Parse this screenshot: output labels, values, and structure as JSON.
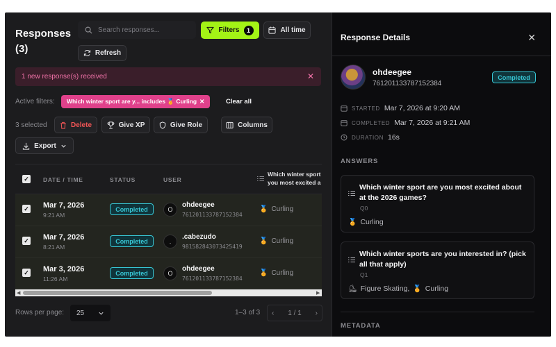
{
  "title": {
    "line1": "Responses",
    "line2": "(3)"
  },
  "search": {
    "placeholder": "Search responses..."
  },
  "toolbar": {
    "filters_label": "Filters",
    "filters_count": "1",
    "alltime_label": "All time",
    "refresh_label": "Refresh",
    "delete_label": "Delete",
    "givexp_label": "Give XP",
    "giverole_label": "Give Role",
    "columns_label": "Columns",
    "export_label": "Export"
  },
  "notice": {
    "text": "1 new response(s) received"
  },
  "active_filters": {
    "label": "Active filters:",
    "chip": "Which winter sport are y... includes 🏅 Curling",
    "clear_all": "Clear all"
  },
  "selected_text": "3 selected",
  "table": {
    "headers": {
      "date": "DATE / TIME",
      "status": "STATUS",
      "user": "USER",
      "question": "Which winter sport",
      "question2": "you most excited a"
    },
    "rows": [
      {
        "date": "Mar 7, 2026",
        "time": "9:21 AM",
        "status": "Completed",
        "avatar": "O",
        "user": "ohdeegee",
        "uid": "761201133787152384",
        "answer": "Curling"
      },
      {
        "date": "Mar 7, 2026",
        "time": "8:21 AM",
        "status": "Completed",
        "avatar": ".",
        "user": ".cabezudo",
        "uid": "981582843073425419",
        "answer": "Curling"
      },
      {
        "date": "Mar 3, 2026",
        "time": "11:26 AM",
        "status": "Completed",
        "avatar": "O",
        "user": "ohdeegee",
        "uid": "761201133787152384",
        "answer": "Curling"
      }
    ]
  },
  "pagination": {
    "rows_label": "Rows per page:",
    "rows_value": "25",
    "range": "1–3 of 3",
    "pages": "1 / 1"
  },
  "panel": {
    "title": "Response Details",
    "user": "ohdeegee",
    "uid": "761201133787152384",
    "status": "Completed",
    "started_label": "STARTED",
    "started": "Mar 7, 2026 at 9:20 AM",
    "completed_label": "COMPLETED",
    "completed": "Mar 7, 2026 at 9:21 AM",
    "duration_label": "DURATION",
    "duration": "16s",
    "answers_heading": "ANSWERS",
    "answers": [
      {
        "question": "Which winter sport are you most excited about at the 2026 games?",
        "qid": "Q0",
        "answer": "Curling"
      },
      {
        "question": "Which winter sports are you interested in? (pick all that apply)",
        "qid": "Q1",
        "answer1": "Figure Skating,",
        "answer2": "Curling"
      }
    ],
    "metadata_heading": "METADATA"
  },
  "icons": {
    "medal": "medal-icon",
    "skate": "skate-icon"
  }
}
